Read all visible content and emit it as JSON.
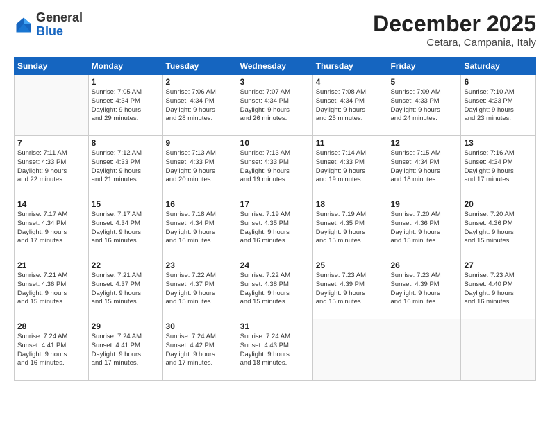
{
  "logo": {
    "general": "General",
    "blue": "Blue"
  },
  "header": {
    "month": "December 2025",
    "location": "Cetara, Campania, Italy"
  },
  "weekdays": [
    "Sunday",
    "Monday",
    "Tuesday",
    "Wednesday",
    "Thursday",
    "Friday",
    "Saturday"
  ],
  "weeks": [
    [
      {
        "day": "",
        "info": ""
      },
      {
        "day": "1",
        "info": "Sunrise: 7:05 AM\nSunset: 4:34 PM\nDaylight: 9 hours\nand 29 minutes."
      },
      {
        "day": "2",
        "info": "Sunrise: 7:06 AM\nSunset: 4:34 PM\nDaylight: 9 hours\nand 28 minutes."
      },
      {
        "day": "3",
        "info": "Sunrise: 7:07 AM\nSunset: 4:34 PM\nDaylight: 9 hours\nand 26 minutes."
      },
      {
        "day": "4",
        "info": "Sunrise: 7:08 AM\nSunset: 4:34 PM\nDaylight: 9 hours\nand 25 minutes."
      },
      {
        "day": "5",
        "info": "Sunrise: 7:09 AM\nSunset: 4:33 PM\nDaylight: 9 hours\nand 24 minutes."
      },
      {
        "day": "6",
        "info": "Sunrise: 7:10 AM\nSunset: 4:33 PM\nDaylight: 9 hours\nand 23 minutes."
      }
    ],
    [
      {
        "day": "7",
        "info": "Sunrise: 7:11 AM\nSunset: 4:33 PM\nDaylight: 9 hours\nand 22 minutes."
      },
      {
        "day": "8",
        "info": "Sunrise: 7:12 AM\nSunset: 4:33 PM\nDaylight: 9 hours\nand 21 minutes."
      },
      {
        "day": "9",
        "info": "Sunrise: 7:13 AM\nSunset: 4:33 PM\nDaylight: 9 hours\nand 20 minutes."
      },
      {
        "day": "10",
        "info": "Sunrise: 7:13 AM\nSunset: 4:33 PM\nDaylight: 9 hours\nand 19 minutes."
      },
      {
        "day": "11",
        "info": "Sunrise: 7:14 AM\nSunset: 4:33 PM\nDaylight: 9 hours\nand 19 minutes."
      },
      {
        "day": "12",
        "info": "Sunrise: 7:15 AM\nSunset: 4:34 PM\nDaylight: 9 hours\nand 18 minutes."
      },
      {
        "day": "13",
        "info": "Sunrise: 7:16 AM\nSunset: 4:34 PM\nDaylight: 9 hours\nand 17 minutes."
      }
    ],
    [
      {
        "day": "14",
        "info": "Sunrise: 7:17 AM\nSunset: 4:34 PM\nDaylight: 9 hours\nand 17 minutes."
      },
      {
        "day": "15",
        "info": "Sunrise: 7:17 AM\nSunset: 4:34 PM\nDaylight: 9 hours\nand 16 minutes."
      },
      {
        "day": "16",
        "info": "Sunrise: 7:18 AM\nSunset: 4:34 PM\nDaylight: 9 hours\nand 16 minutes."
      },
      {
        "day": "17",
        "info": "Sunrise: 7:19 AM\nSunset: 4:35 PM\nDaylight: 9 hours\nand 16 minutes."
      },
      {
        "day": "18",
        "info": "Sunrise: 7:19 AM\nSunset: 4:35 PM\nDaylight: 9 hours\nand 15 minutes."
      },
      {
        "day": "19",
        "info": "Sunrise: 7:20 AM\nSunset: 4:36 PM\nDaylight: 9 hours\nand 15 minutes."
      },
      {
        "day": "20",
        "info": "Sunrise: 7:20 AM\nSunset: 4:36 PM\nDaylight: 9 hours\nand 15 minutes."
      }
    ],
    [
      {
        "day": "21",
        "info": "Sunrise: 7:21 AM\nSunset: 4:36 PM\nDaylight: 9 hours\nand 15 minutes."
      },
      {
        "day": "22",
        "info": "Sunrise: 7:21 AM\nSunset: 4:37 PM\nDaylight: 9 hours\nand 15 minutes."
      },
      {
        "day": "23",
        "info": "Sunrise: 7:22 AM\nSunset: 4:37 PM\nDaylight: 9 hours\nand 15 minutes."
      },
      {
        "day": "24",
        "info": "Sunrise: 7:22 AM\nSunset: 4:38 PM\nDaylight: 9 hours\nand 15 minutes."
      },
      {
        "day": "25",
        "info": "Sunrise: 7:23 AM\nSunset: 4:39 PM\nDaylight: 9 hours\nand 15 minutes."
      },
      {
        "day": "26",
        "info": "Sunrise: 7:23 AM\nSunset: 4:39 PM\nDaylight: 9 hours\nand 16 minutes."
      },
      {
        "day": "27",
        "info": "Sunrise: 7:23 AM\nSunset: 4:40 PM\nDaylight: 9 hours\nand 16 minutes."
      }
    ],
    [
      {
        "day": "28",
        "info": "Sunrise: 7:24 AM\nSunset: 4:41 PM\nDaylight: 9 hours\nand 16 minutes."
      },
      {
        "day": "29",
        "info": "Sunrise: 7:24 AM\nSunset: 4:41 PM\nDaylight: 9 hours\nand 17 minutes."
      },
      {
        "day": "30",
        "info": "Sunrise: 7:24 AM\nSunset: 4:42 PM\nDaylight: 9 hours\nand 17 minutes."
      },
      {
        "day": "31",
        "info": "Sunrise: 7:24 AM\nSunset: 4:43 PM\nDaylight: 9 hours\nand 18 minutes."
      },
      {
        "day": "",
        "info": ""
      },
      {
        "day": "",
        "info": ""
      },
      {
        "day": "",
        "info": ""
      }
    ]
  ]
}
